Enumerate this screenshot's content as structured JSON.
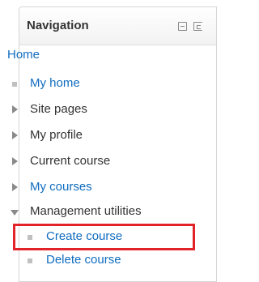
{
  "block": {
    "title": "Navigation",
    "home_label": "Home",
    "items": [
      {
        "label": "My home",
        "kind": "link",
        "icon": "bullet"
      },
      {
        "label": "Site pages",
        "kind": "plain",
        "icon": "expand-arrow"
      },
      {
        "label": "My profile",
        "kind": "plain",
        "icon": "expand-arrow"
      },
      {
        "label": "Current course",
        "kind": "plain",
        "icon": "expand-arrow"
      },
      {
        "label": "My courses",
        "kind": "link",
        "icon": "expand-arrow"
      },
      {
        "label": "Management utilities",
        "kind": "plain",
        "icon": "collapse-arrow"
      }
    ],
    "subitems": [
      {
        "label": "Create course",
        "kind": "link",
        "icon": "bullet",
        "highlighted": true
      },
      {
        "label": "Delete course",
        "kind": "link",
        "icon": "bullet"
      }
    ]
  },
  "colors": {
    "link": "#0f6cbf",
    "text": "#333333",
    "highlight": "#e2232a"
  }
}
